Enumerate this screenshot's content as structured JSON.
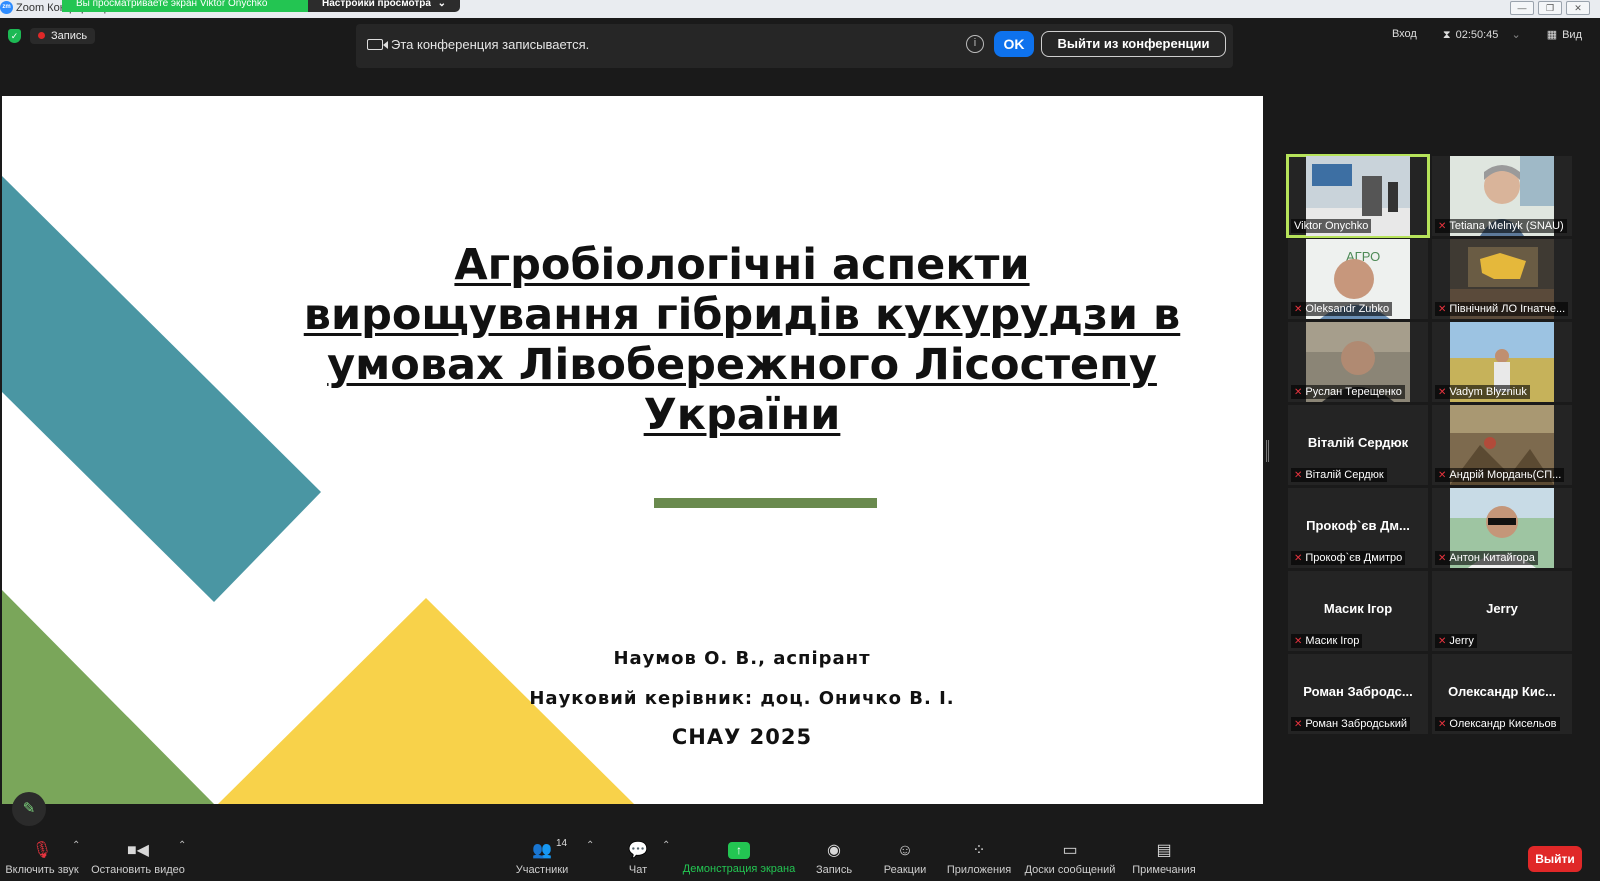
{
  "window": {
    "title": "Zoom Конференция",
    "share_banner": "Вы просматриваете экран Viktor Onychko",
    "view_settings": "Настройки просмотра"
  },
  "top_bar": {
    "recording_label": "Запись",
    "notice_text": "Эта конференция записывается.",
    "ok_label": "OK",
    "leave_meeting_label": "Выйти из конференции",
    "signin_label": "Вход",
    "timer": "02:50:45",
    "view_label": "Вид"
  },
  "slide": {
    "title": "Агробіологічні аспекти вирощування гібридів кукурудзи в умовах Лівобережного Лісостепу України",
    "author": "Наумов О. В., аспірант",
    "supervisor": "Науковий керівник: доц. Оничко В. І.",
    "year": "СНАУ 2025",
    "colors": {
      "teal": "#4a96a3",
      "green": "#7aa65a",
      "yellow": "#f8d24a",
      "bar": "#6a8a4e"
    }
  },
  "participants": [
    {
      "display": "",
      "label": "Viktor Onychko",
      "muted": false,
      "active": true,
      "video": "office"
    },
    {
      "display": "",
      "label": "Tetiana Melnyk (SNAU)",
      "muted": true,
      "active": false,
      "video": "woman"
    },
    {
      "display": "",
      "label": "Oleksandr Zubko",
      "muted": true,
      "active": false,
      "video": "man-agro"
    },
    {
      "display": "",
      "label": "Північний ЛО Ігнатче...",
      "muted": true,
      "active": false,
      "video": "map-room"
    },
    {
      "display": "",
      "label": "Руслан Терещенко",
      "muted": true,
      "active": false,
      "video": "man-dark"
    },
    {
      "display": "",
      "label": "Vadym Blyzniuk",
      "muted": true,
      "active": false,
      "video": "field"
    },
    {
      "display": "Віталій Сердюк",
      "label": "Віталій Сердюк",
      "muted": true,
      "active": false,
      "video": ""
    },
    {
      "display": "",
      "label": "Андрій Мордань(СП...",
      "muted": true,
      "active": false,
      "video": "painting"
    },
    {
      "display": "Прокоф`єв Дм...",
      "label": "Прокоф`єв Дмитро",
      "muted": true,
      "active": false,
      "video": ""
    },
    {
      "display": "",
      "label": "Антон Китайгора",
      "muted": true,
      "active": false,
      "video": "man-glasses"
    },
    {
      "display": "Масик Ігор",
      "label": "Масик Ігор",
      "muted": true,
      "active": false,
      "video": ""
    },
    {
      "display": "Jerry",
      "label": "Jerry",
      "muted": true,
      "active": false,
      "video": ""
    },
    {
      "display": "Роман Забродс...",
      "label": "Роман Забродський",
      "muted": true,
      "active": false,
      "video": ""
    },
    {
      "display": "Олександр Кис...",
      "label": "Олександр Кисельов",
      "muted": true,
      "active": false,
      "video": ""
    }
  ],
  "toolbar": {
    "unmute": "Включить звук",
    "stop_video": "Остановить видео",
    "participants": "Участники",
    "participants_count": "14",
    "chat": "Чат",
    "share_screen": "Демонстрация экрана",
    "record": "Запись",
    "reactions": "Реакции",
    "apps": "Приложения",
    "whiteboards": "Доски сообщений",
    "notes": "Примечания",
    "leave": "Выйти"
  }
}
